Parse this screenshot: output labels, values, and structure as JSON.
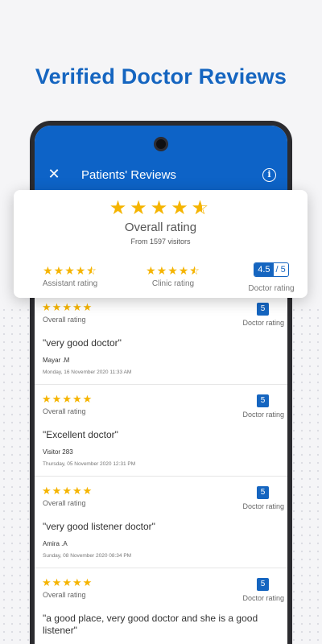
{
  "headline": "Verified Doctor Reviews",
  "appbar": {
    "close_icon": "✕",
    "title": "Patients' Reviews",
    "info_icon": "i"
  },
  "summary": {
    "stars_value": 4.5,
    "overall_label": "Overall rating",
    "from_text": "From 1597 visitors",
    "assistant": {
      "stars_value": 4.5,
      "label": "Assistant rating"
    },
    "clinic": {
      "stars_value": 4.5,
      "label": "Clinic rating"
    },
    "doctor": {
      "value": "4.5",
      "denominator": "/ 5",
      "label": "Doctor rating"
    }
  },
  "reviews": [
    {
      "stars_value": 5,
      "overall_label": "Overall rating",
      "doctor_value": "5",
      "doctor_label": "Doctor rating",
      "quote": "\"very good doctor\"",
      "author": "Mayar .M",
      "date": "Monday, 16 November 2020 11:33 AM"
    },
    {
      "stars_value": 5,
      "overall_label": "Overall rating",
      "doctor_value": "5",
      "doctor_label": "Doctor rating",
      "quote": "\"Excellent doctor\"",
      "author": "Visitor 283",
      "date": "Thursday, 05 November 2020 12:31 PM"
    },
    {
      "stars_value": 5,
      "overall_label": "Overall rating",
      "doctor_value": "5",
      "doctor_label": "Doctor rating",
      "quote": "\"very good listener doctor\"",
      "author": "Amira .A",
      "date": "Sunday, 08 November 2020 08:34 PM"
    },
    {
      "stars_value": 5,
      "overall_label": "Overall rating",
      "doctor_value": "5",
      "doctor_label": "Doctor rating",
      "quote": "\"a good place, very good doctor and she is a good listener\"",
      "author": "",
      "date": ""
    }
  ],
  "colors": {
    "brand_blue": "#1565c0",
    "appbar_blue": "#0d63c7",
    "star_gold": "#f5b400"
  }
}
